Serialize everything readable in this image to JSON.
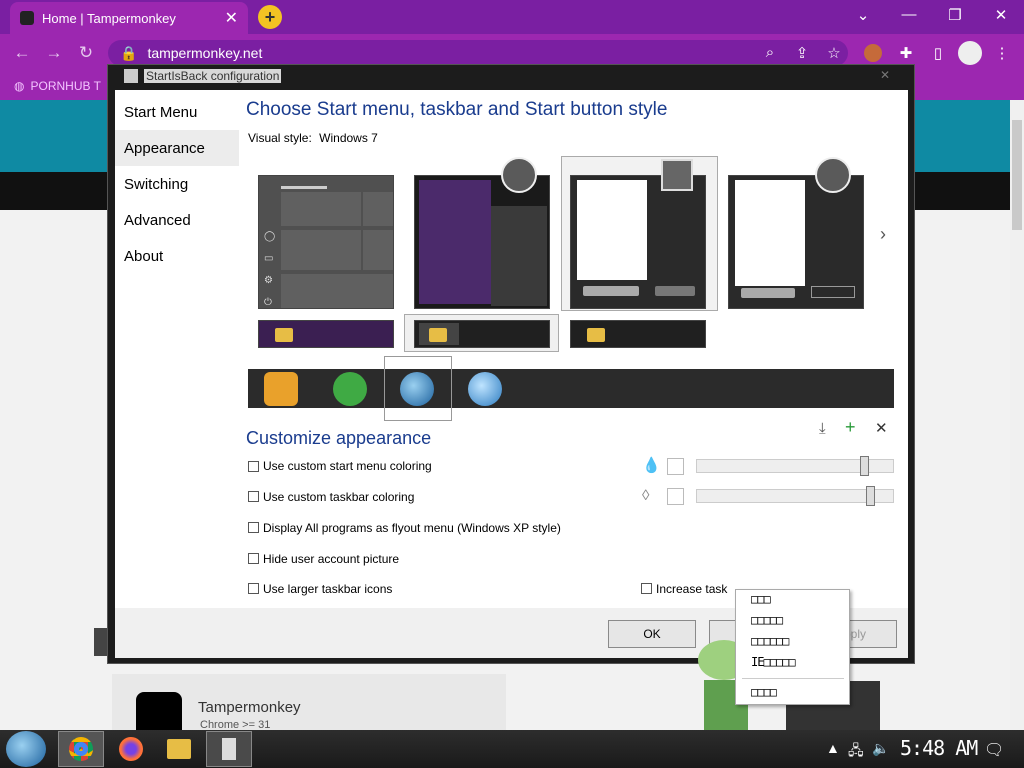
{
  "browser": {
    "tab_title": "Home | Tampermonkey",
    "url": "tampermonkey.net",
    "bookmark": "PORNHUB T",
    "page": {
      "card_title": "Tampermonkey",
      "card_subtitle": "Chrome >= 31"
    }
  },
  "dialog": {
    "title": "StartIsBack configuration",
    "nav": [
      "Start Menu",
      "Appearance",
      "Switching",
      "Advanced",
      "About"
    ],
    "selected_nav": "Appearance",
    "heading": "Choose Start menu, taskbar and Start button style",
    "visual_style_label": "Visual style:",
    "visual_style_value": "Windows 7",
    "customize_heading": "Customize appearance",
    "options": {
      "custom_start_coloring": "Use custom start menu coloring",
      "custom_taskbar_coloring": "Use custom taskbar coloring",
      "flyout": "Display All programs as flyout menu (Windows XP style)",
      "hide_picture": "Hide user account picture",
      "larger_icons": "Use larger taskbar icons",
      "increase_task": "Increase task"
    },
    "sliders": {
      "start_opacity": 0.85,
      "taskbar_opacity": 0.88
    },
    "buttons": {
      "ok": "OK",
      "apply": "pply"
    }
  },
  "context_menu": {
    "items": [
      "□□□",
      "□□□□□",
      "□□□□□□",
      "IE□□□□□",
      "□□□□"
    ]
  },
  "taskbar": {
    "clock": "5:48 AM"
  }
}
